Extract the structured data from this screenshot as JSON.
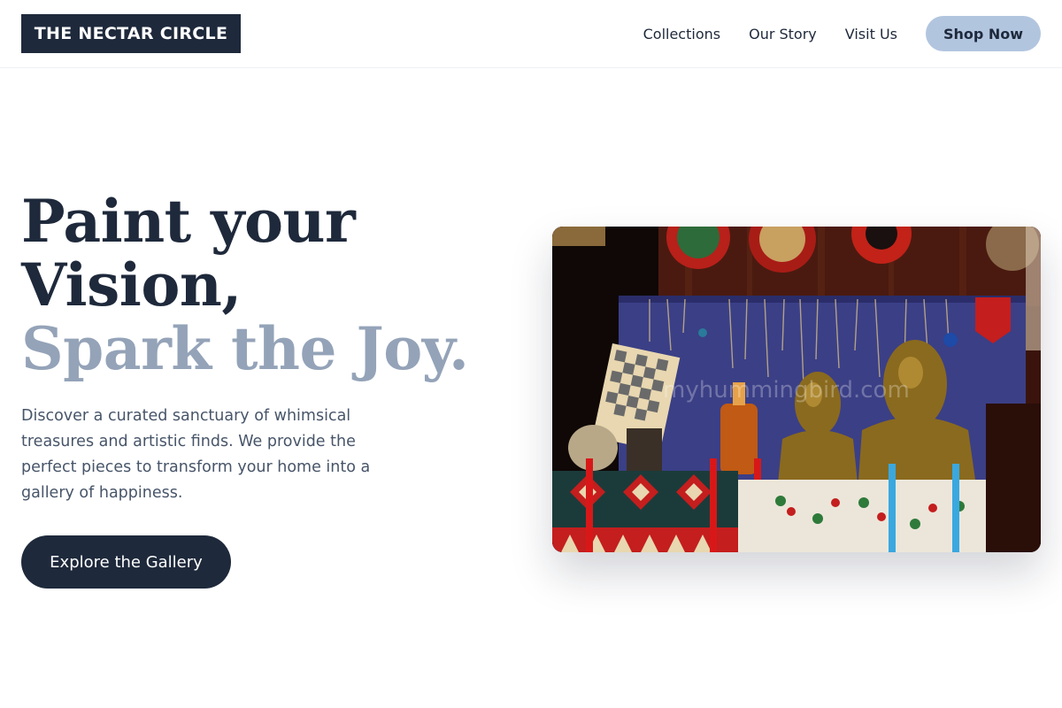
{
  "brand": {
    "name": "THE NECTAR CIRCLE"
  },
  "nav": {
    "links": [
      "Collections",
      "Our Story",
      "Visit Us"
    ],
    "cta_label": "Shop Now"
  },
  "hero": {
    "headline_line1": "Paint your",
    "headline_line2": "Vision,",
    "headline_accent": "Spark the Joy.",
    "description": "Discover a curated sanctuary of whimsical treasures and artistic finds. We provide the perfect pieces to transform your home into a gallery of happiness.",
    "cta_label": "Explore the Gallery",
    "image_alt": "Market stall with decorative plates, chess board, bronze busts and embroidered textiles",
    "image_watermark": "myhummingbird.com"
  },
  "colors": {
    "primary_dark": "#1e293b",
    "accent_muted": "#94a3b8",
    "nav_cta_bg": "#b2c5df",
    "body_text": "#475569"
  }
}
